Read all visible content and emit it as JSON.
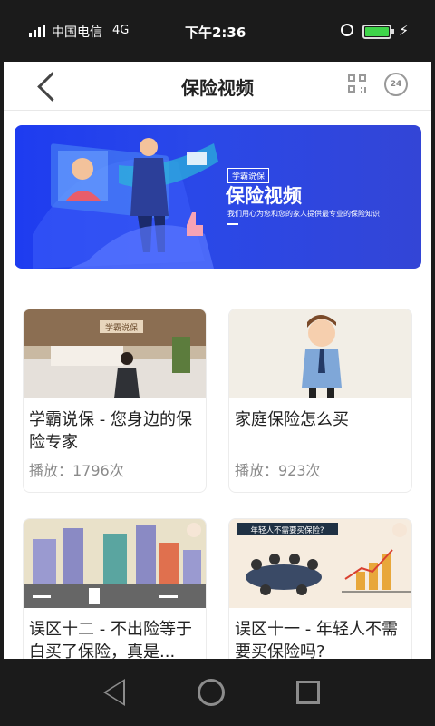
{
  "status_bar": {
    "carrier": "中国电信",
    "network": "4G",
    "time": "下午2:36",
    "battery_percent": 100,
    "icons": [
      "signal-icon",
      "alarm-icon",
      "battery-icon",
      "charging-icon"
    ]
  },
  "nav": {
    "title": "保险视频",
    "icons": [
      "back-chevron-icon",
      "qr-code-icon",
      "phone-24h-icon"
    ],
    "phone_badge": "24"
  },
  "banner": {
    "tag": "学霸说保",
    "title": "保险视频",
    "subtitle": "我们用心为您和您的家人提供最专业的保险知识"
  },
  "videos": [
    {
      "title": "学霸说保 - 您身边的保险专家",
      "plays": "播放：1796次",
      "thumb_bg": "#c9b9a2"
    },
    {
      "title": "家庭保险怎么买",
      "plays": "播放：923次",
      "thumb_bg": "#f2eee6"
    },
    {
      "title": "误区十二 - 不出险等于白买了保险，真是...",
      "plays": "",
      "thumb_bg": "#e9e1c9"
    },
    {
      "title": "误区十一 - 年轻人不需要买保险吗?",
      "plays": "",
      "thumb_bg": "#f6ecdf",
      "thumb_caption": "年轻人不需要买保险?"
    }
  ],
  "system_nav": {
    "icons": [
      "nav-back-icon",
      "nav-home-icon",
      "nav-recent-icon"
    ]
  },
  "colors": {
    "banner": "#2a48e8",
    "accent_orange": "#f0a030",
    "play_count": "#8a8a8a"
  }
}
